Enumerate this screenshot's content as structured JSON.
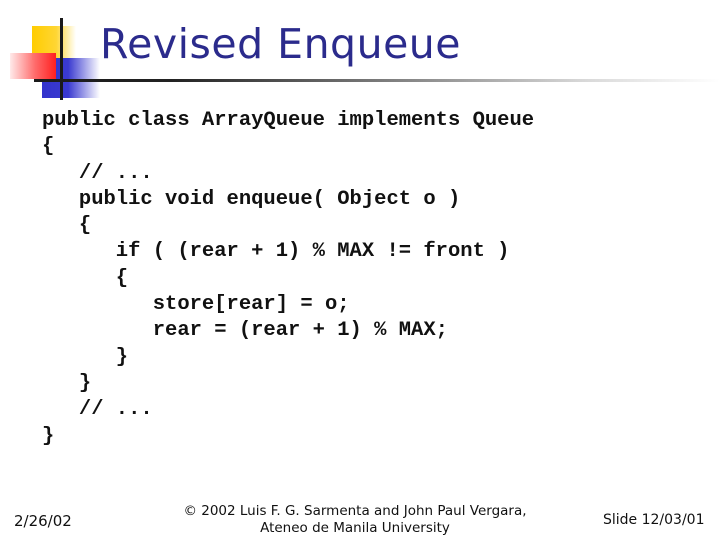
{
  "slide": {
    "title": "Revised Enqueue",
    "code_lines": [
      "public class ArrayQueue implements Queue",
      "{",
      "   // ...",
      "   public void enqueue( Object o )",
      "   {",
      "      if ( (rear + 1) % MAX != front )",
      "      {",
      "         store[rear] = o;",
      "         rear = (rear + 1) % MAX;",
      "      }",
      "   }",
      "   // ...",
      "}"
    ]
  },
  "footer": {
    "date": "2/26/02",
    "copyright_line1": "© 2002 Luis F. G. Sarmenta and John Paul Vergara,",
    "copyright_line2": "Ateneo de Manila University",
    "slide_label": "Slide 12/03/01"
  },
  "colors": {
    "title": "#2b2b8c",
    "logo_yellow": "#ffcc00",
    "logo_blue": "#3333cc",
    "logo_red": "#ff2020"
  }
}
